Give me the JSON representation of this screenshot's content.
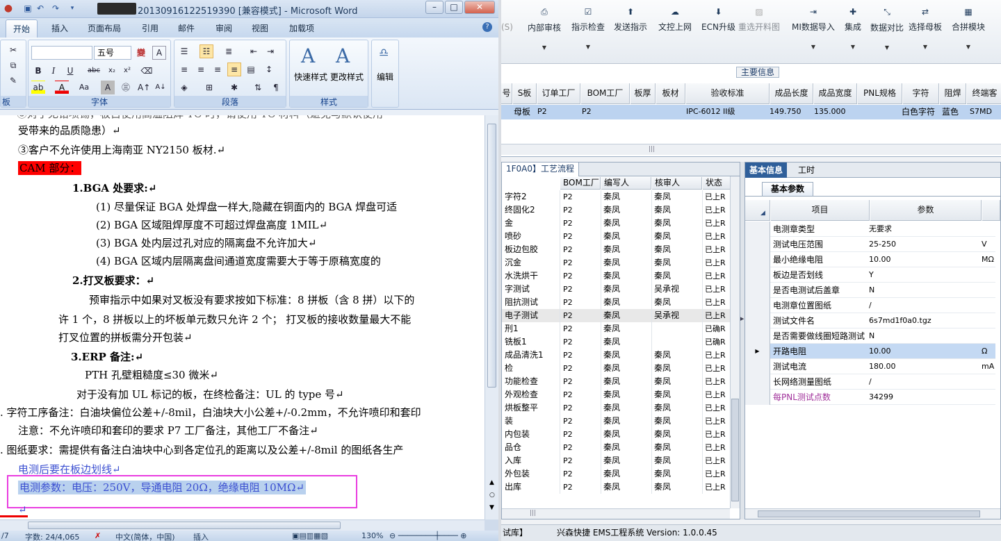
{
  "word": {
    "title": "20130916122519390 [兼容模式] - Microsoft Word",
    "tabs": [
      "开始",
      "插入",
      "页面布局",
      "引用",
      "邮件",
      "审阅",
      "视图",
      "加载项"
    ],
    "ribbon": {
      "font_size": "五号",
      "group_font": "字体",
      "group_paragraph": "段落",
      "group_styles": "样式",
      "quick_styles": "快速样式",
      "change_styles": "更改样式",
      "edit": "编辑",
      "clipboard_partial": "板"
    },
    "document": {
      "lines": [
        "受带来的品质隐患）↵",
        "③客户不允许使用上海南亚 NY2150 板材.↵",
        "CAM 部分：",
        "1.BGA 处要求:↵",
        "(1) 尽量保证 BGA 处焊盘一样大,隐藏在铜面内的 BGA 焊盘可适",
        "(2) BGA 区域阻焊厚度不可超过焊盘高度 1MIL↵",
        "(3) BGA 处内层过孔对应的隔离盘不允许加大↵",
        "(4) BGA 区域内层隔离盘间通道宽度需要大于等于原稿宽度的",
        "2.打叉板要求：↵",
        "预审指示中如果对叉板没有要求按如下标准：8 拼板（含 8 拼）以下的",
        "许 1 个，8 拼板以上的坏板单元数只允许 2 个；  打叉板的接收数量最大不能",
        "打叉位置的拼板需分开包装↵",
        "3.ERP 备注:↵",
        "PTH 孔壁粗糙度≤30 微米↵",
        "对于没有加 UL 标记的板，在终检备注：UL 的 type 号↵",
        ". 字符工序备注：白油块偏位公差+/-8mil，白油块大小公差+/-0.2mm，不允许喷印和套印",
        "注意：不允许喷印和套印的要求 P7 工厂备注，其他工厂不备注↵",
        ".   图纸要求：需提供有备注白油块中心到各定位孔的距离以及公差+/-8mil 的图纸各生产",
        "电测后要在板边划线↵",
        "电测参数：电压：250V，导通电阻 20Ω，绝缘电阻 10MΩ↵",
        "↵"
      ]
    },
    "status": {
      "page": "/7",
      "words": "字数: 24/4,065",
      "lang": "中文(简体，中国)",
      "insert": "插入",
      "zoom": "130%"
    }
  },
  "ems": {
    "toolbar": [
      "内部审核",
      "指示检查",
      "发送指示",
      "文控上网",
      "ECN升级",
      "重选开料图",
      "MI数据导入",
      "集成",
      "数据对比",
      "选择母板",
      "合拼模块"
    ],
    "toolbar_partial": "(S)",
    "main_title": "主要信息",
    "main_headers": [
      "号",
      "S板",
      "订单工厂",
      "BOM工厂",
      "板厚",
      "板材",
      "验收标准",
      "成品长度",
      "成品宽度",
      "PNL规格",
      "字符",
      "阻焊",
      "终端客"
    ],
    "main_row": [
      "母板",
      "P2",
      "P2",
      "IPC-6012 II级",
      "149.750",
      "135.000",
      "白色字符",
      "蓝色",
      "S7MD"
    ],
    "process_tab": "1F0A0】工艺流程",
    "process_headers": [
      "BOM工厂",
      "编写人",
      "核审人",
      "状态"
    ],
    "process_rows": [
      {
        "name": "字符2",
        "bom": "P2",
        "writer": "秦凤",
        "reviewer": "秦凤",
        "status": "已上R"
      },
      {
        "name": "终固化2",
        "bom": "P2",
        "writer": "秦凤",
        "reviewer": "秦凤",
        "status": "已上R"
      },
      {
        "name": "金",
        "bom": "P2",
        "writer": "秦凤",
        "reviewer": "秦凤",
        "status": "已上R"
      },
      {
        "name": "喷砂",
        "bom": "P2",
        "writer": "秦凤",
        "reviewer": "秦凤",
        "status": "已上R"
      },
      {
        "name": "板边包胶",
        "bom": "P2",
        "writer": "秦凤",
        "reviewer": "秦凤",
        "status": "已上R"
      },
      {
        "name": "沉金",
        "bom": "P2",
        "writer": "秦凤",
        "reviewer": "秦凤",
        "status": "已上R"
      },
      {
        "name": "水洗烘干",
        "bom": "P2",
        "writer": "秦凤",
        "reviewer": "秦凤",
        "status": "已上R"
      },
      {
        "name": "字测试",
        "bom": "P2",
        "writer": "秦凤",
        "reviewer": "吴承视",
        "status": "已上R"
      },
      {
        "name": "阻抗测试",
        "bom": "P2",
        "writer": "秦凤",
        "reviewer": "秦凤",
        "status": "已上R"
      },
      {
        "name": "电子测试",
        "bom": "P2",
        "writer": "秦凤",
        "reviewer": "吴承视",
        "status": "已上R"
      },
      {
        "name": "刑1",
        "bom": "P2",
        "writer": "秦凤",
        "reviewer": "",
        "status": "已确R"
      },
      {
        "name": "铣板1",
        "bom": "P2",
        "writer": "秦凤",
        "reviewer": "",
        "status": "已确R"
      },
      {
        "name": "成品清洗1",
        "bom": "P2",
        "writer": "秦凤",
        "reviewer": "秦凤",
        "status": "已上R"
      },
      {
        "name": "检",
        "bom": "P2",
        "writer": "秦凤",
        "reviewer": "秦凤",
        "status": "已上R"
      },
      {
        "name": "功能检查",
        "bom": "P2",
        "writer": "秦凤",
        "reviewer": "秦凤",
        "status": "已上R"
      },
      {
        "name": "外观检查",
        "bom": "P2",
        "writer": "秦凤",
        "reviewer": "秦凤",
        "status": "已上R"
      },
      {
        "name": "烘板整平",
        "bom": "P2",
        "writer": "秦凤",
        "reviewer": "秦凤",
        "status": "已上R"
      },
      {
        "name": "装",
        "bom": "P2",
        "writer": "秦凤",
        "reviewer": "秦凤",
        "status": "已上R"
      },
      {
        "name": "内包装",
        "bom": "P2",
        "writer": "秦凤",
        "reviewer": "秦凤",
        "status": "已上R"
      },
      {
        "name": "品仓",
        "bom": "P2",
        "writer": "秦凤",
        "reviewer": "秦凤",
        "status": "已上R"
      },
      {
        "name": "入库",
        "bom": "P2",
        "writer": "秦凤",
        "reviewer": "秦凤",
        "status": "已上R"
      },
      {
        "name": "外包装",
        "bom": "P2",
        "writer": "秦凤",
        "reviewer": "秦凤",
        "status": "已上R"
      },
      {
        "name": "出库",
        "bom": "P2",
        "writer": "秦凤",
        "reviewer": "秦凤",
        "status": "已上R"
      }
    ],
    "info_tabs": [
      "基本信息",
      "工时"
    ],
    "info_subtab": "基本参数",
    "info_headers": [
      "项目",
      "参数"
    ],
    "info_rows": [
      {
        "item": "电测章类型",
        "value": "无要求",
        "unit": ""
      },
      {
        "item": "测试电压范围",
        "value": "25-250",
        "unit": "V"
      },
      {
        "item": "最小绝缘电阻",
        "value": "10.00",
        "unit": "MΩ"
      },
      {
        "item": "板边是否划线",
        "value": "Y",
        "unit": ""
      },
      {
        "item": "是否电测试后盖章",
        "value": "N",
        "unit": ""
      },
      {
        "item": "电测章位置图纸",
        "value": "/",
        "unit": ""
      },
      {
        "item": "测试文件名",
        "value": "6s7md1f0a0.tgz",
        "unit": ""
      },
      {
        "item": "是否需要做线圈短路测试",
        "value": "N",
        "unit": ""
      },
      {
        "item": "开路电阻",
        "value": "10.00",
        "unit": "Ω"
      },
      {
        "item": "测试电流",
        "value": "180.00",
        "unit": "mA"
      },
      {
        "item": "长网络测量图纸",
        "value": "/",
        "unit": ""
      },
      {
        "item": "每PNL测试点数",
        "value": "34299",
        "unit": ""
      }
    ],
    "status": {
      "left": "试库】",
      "text": "兴森快捷 EMS工程系统 Version: 1.0.0.45"
    }
  }
}
